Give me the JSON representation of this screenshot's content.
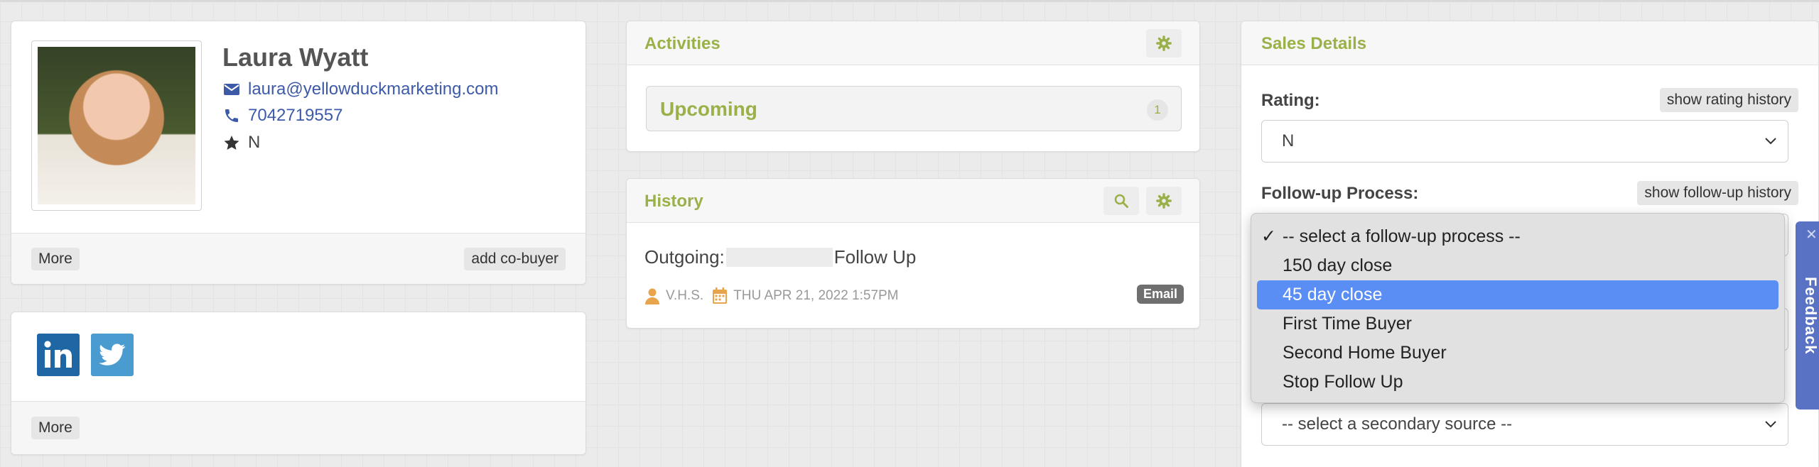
{
  "contact": {
    "name": "Laura Wyatt",
    "email": "laura@yellowduckmarketing.com",
    "phone": "7042719557",
    "rating": "N",
    "more_label": "More",
    "add_cobuyer_label": "add co-buyer"
  },
  "social": {
    "more_label": "More",
    "icons": [
      "linkedin-icon",
      "twitter-icon"
    ]
  },
  "activities": {
    "title": "Activities",
    "upcoming_label": "Upcoming",
    "upcoming_count": "1"
  },
  "history": {
    "title": "History",
    "outgoing_prefix": "Outgoing:",
    "follow_up": "Follow Up",
    "author": "V.H.S.",
    "date": "THU APR 21, 2022 1:57PM",
    "badge": "Email"
  },
  "sales": {
    "title": "Sales Details",
    "rating_label": "Rating:",
    "rating_history_button": "show rating history",
    "rating_value": "N",
    "followup_label": "Follow-up Process:",
    "followup_history_button": "show follow-up history",
    "secondary_source_placeholder": "-- select a secondary source --"
  },
  "followup_dropdown": {
    "options": [
      "-- select a follow-up process --",
      "150 day close",
      "45 day close",
      "First Time Buyer",
      "Second Home Buyer",
      "Stop Follow Up"
    ],
    "checked": "-- select a follow-up process --",
    "highlighted": "45 day close"
  },
  "feedback_label": "Feedback",
  "colors": {
    "accent_green": "#9ab14a",
    "link_blue": "#3d5aa8",
    "highlight_blue": "#5b8ef4",
    "feedback_blue": "#5a72c4"
  }
}
